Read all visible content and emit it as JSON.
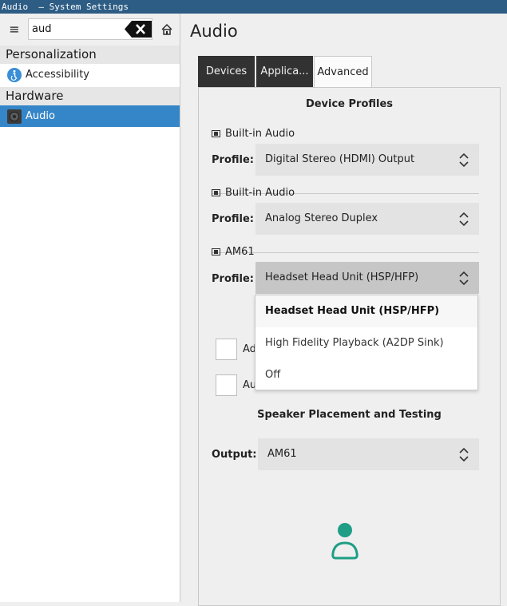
{
  "window": {
    "title": "Audio  — System Settings"
  },
  "sidebar": {
    "search": {
      "value": "aud",
      "placeholder": ""
    },
    "categories": [
      {
        "label": "Personalization",
        "items": [
          {
            "label": "Accessibility",
            "icon": "accessibility-icon"
          }
        ]
      },
      {
        "label": "Hardware",
        "items": [
          {
            "label": "Audio",
            "icon": "speaker-icon",
            "selected": true
          }
        ]
      }
    ]
  },
  "main": {
    "title": "Audio",
    "tabs": [
      {
        "label": "Devices",
        "active": false
      },
      {
        "label": "Applica...",
        "active": false
      },
      {
        "label": "Advanced",
        "active": true
      }
    ],
    "device_profiles": {
      "heading": "Device Profiles",
      "profile_label": "Profile:",
      "devices": [
        {
          "name": "Built-in Audio",
          "profile": "Digital Stereo (HDMI) Output"
        },
        {
          "name": "Built-in Audio",
          "profile": "Analog Stereo Duplex"
        },
        {
          "name": "AM61",
          "profile": "Headset Head Unit (HSP/HFP)"
        }
      ],
      "dropdown_options": [
        {
          "label": "Headset Head Unit (HSP/HFP)",
          "selected": true
        },
        {
          "label": "High Fidelity Playback (A2DP Sink)",
          "selected": false
        },
        {
          "label": "Off",
          "selected": false
        }
      ]
    },
    "checkboxes": [
      {
        "label": "Ad",
        "checked": false
      },
      {
        "label": "Au",
        "checked": false
      }
    ],
    "speaker": {
      "heading": "Speaker Placement and Testing",
      "output_label": "Output:",
      "output_value": "AM61"
    }
  },
  "colors": {
    "titlebar": "#2d5c84",
    "selection": "#3586c8",
    "tab_dark": "#323232",
    "person": "#1f9e85"
  }
}
